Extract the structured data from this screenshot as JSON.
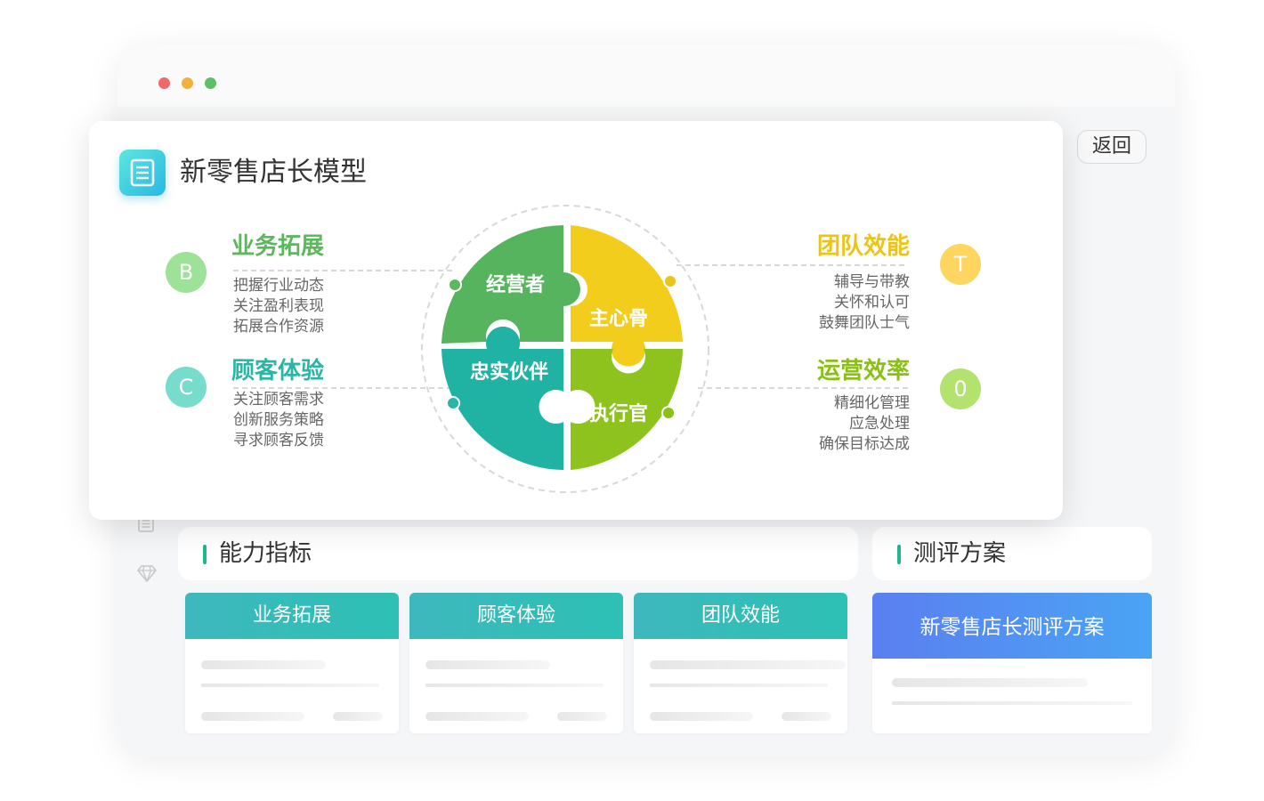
{
  "window": {
    "dot_colors": [
      "#ec6a6a",
      "#f1b23b",
      "#5fbf68"
    ],
    "back_label": "返回",
    "sidebar_icons": [
      "list-icon",
      "diamond-icon"
    ]
  },
  "ability": {
    "title": "能力指标",
    "cards": [
      {
        "label": "业务拓展"
      },
      {
        "label": "顾客体验"
      },
      {
        "label": "团队效能"
      }
    ]
  },
  "plan": {
    "title": "测评方案",
    "card_label": "新零售店长测评方案"
  },
  "modal": {
    "title": "新零售店长模型",
    "icon": "document-icon",
    "sections": {
      "B": {
        "letter": "B",
        "title": "业务拓展",
        "color": "#5cb85c",
        "badge_color": "#9ee29a",
        "items": [
          "把握行业动态",
          "关注盈利表现",
          "拓展合作资源"
        ]
      },
      "C": {
        "letter": "C",
        "title": "顾客体验",
        "color": "#2bb5a6",
        "badge_color": "#78dccd",
        "items": [
          "关注顾客需求",
          "创新服务策略",
          "寻求顾客反馈"
        ]
      },
      "T": {
        "letter": "T",
        "title": "团队效能",
        "color": "#ecc419",
        "badge_color": "#fdd55f",
        "items": [
          "辅导与带教",
          "关怀和认可",
          "鼓舞团队士气"
        ]
      },
      "O": {
        "letter": "0",
        "title": "运营效率",
        "color": "#8ac016",
        "badge_color": "#b4e26e",
        "items": [
          "精细化管理",
          "应急处理",
          "确保目标达成"
        ]
      }
    },
    "puzzle": {
      "top_left": {
        "label": "经营者",
        "color": "#56b45e"
      },
      "top_right": {
        "label": "主心骨",
        "color": "#f3cd1b"
      },
      "bottom_left": {
        "label": "忠实伙伴",
        "color": "#20b2a2"
      },
      "bottom_right": {
        "label": "执行官",
        "color": "#8ec21d"
      }
    }
  }
}
